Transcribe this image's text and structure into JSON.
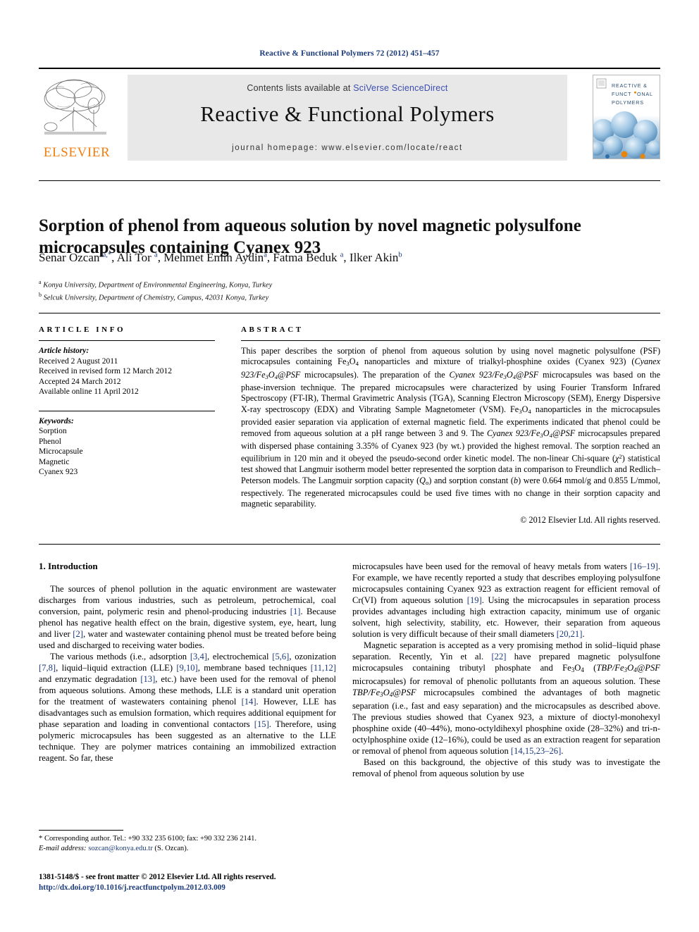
{
  "running_head": "Reactive & Functional Polymers 72 (2012) 451–457",
  "masthead": {
    "publisher_name": "ELSEVIER",
    "contents_prefix": "Contents lists available at ",
    "contents_link": "SciVerse ScienceDirect",
    "journal_title": "Reactive & Functional Polymers",
    "homepage_line": "journal homepage: www.elsevier.com/locate/react",
    "cover_title_line1": "REACTIVE &",
    "cover_title_line2": "FUNCTIONAL",
    "cover_title_line3": "POLYMERS"
  },
  "article": {
    "title": "Sorption of phenol from aqueous solution by novel magnetic polysulfone microcapsules containing Cyanex 923",
    "authors_html": "Senar Ozcan <sup>a,*</sup>, Ali Tor <sup>a</sup>, Mehmet Emin Aydin<sup>a</sup>, Fatma Beduk <sup>a</sup>, Ilker Akin<sup>b</sup>",
    "affiliation_a": "Konya University, Department of Environmental Engineering, Konya, Turkey",
    "affiliation_b": "Selcuk University, Department of Chemistry, Campus, 42031 Konya, Turkey"
  },
  "article_info": {
    "heading": "ARTICLE INFO",
    "history_label": "Article history:",
    "history": [
      "Received 2 August 2011",
      "Received in revised form 12 March 2012",
      "Accepted 24 March 2012",
      "Available online 11 April 2012"
    ],
    "keywords_label": "Keywords:",
    "keywords": [
      "Sorption",
      "Phenol",
      "Microcapsule",
      "Magnetic",
      "Cyanex 923"
    ]
  },
  "abstract": {
    "heading": "ABSTRACT",
    "text_html": "This paper describes the sorption of phenol from aqueous solution by using novel magnetic polysulfone (PSF) microcapsules containing Fe<sub>3</sub>O<sub>4</sub> nanoparticles and mixture of trialkyl-phosphine oxides (Cyanex 923) (<i>Cyanex 923/Fe<sub>3</sub>O<sub>4</sub>@PSF</i> microcapsules). The preparation of the <i>Cyanex 923/Fe<sub>3</sub>O<sub>4</sub>@PSF</i> microcapsules was based on the phase-inversion technique. The prepared microcapsules were characterized by using Fourier Transform Infrared Spectroscopy (FT-IR), Thermal Gravimetric Analysis (TGA), Scanning Electron Microscopy (SEM), Energy Dispersive X-ray spectroscopy (EDX) and Vibrating Sample Magnetometer (VSM). Fe<sub>3</sub>O<sub>4</sub> nanoparticles in the microcapsules provided easier separation via application of external magnetic field. The experiments indicated that phenol could be removed from aqueous solution at a pH range between 3 and 9. The <i>Cyanex 923/Fe<sub>3</sub>O<sub>4</sub>@PSF</i> microcapsules prepared with dispersed phase containing 3.35% of Cyanex 923 (by wt.) provided the highest removal. The sorption reached an equilibrium in 120 min and it obeyed the pseudo-second order kinetic model. The non-linear Chi-square (<i>χ</i><sup class=\"ft\">2</sup>) statistical test showed that Langmuir isotherm model better represented the sorption data in comparison to Freundlich and Redlich–Peterson models. The Langmuir sorption capacity (<i>Q</i><sub>o</sub>) and sorption constant (<i>b</i>) were 0.664 mmol/g and 0.855 L/mmol, respectively. The regenerated microcapsules could be used five times with no change in their sorption capacity and magnetic separability.",
    "copyright": "© 2012 Elsevier Ltd. All rights reserved."
  },
  "body": {
    "section_heading": "1. Introduction",
    "left_paragraphs_html": [
      "The sources of phenol pollution in the aquatic environment are wastewater discharges from various industries, such as petroleum, petrochemical, coal conversion, paint, polymeric resin and phenol-producing industries <span class=\"ref\">[1]</span>. Because phenol has negative health effect on the brain, digestive system, eye, heart, lung and liver <span class=\"ref\">[2]</span>, water and wastewater containing phenol must be treated before being used and discharged to receiving water bodies.",
      "The various methods (i.e., adsorption <span class=\"ref\">[3,4]</span>, electrochemical <span class=\"ref\">[5,6]</span>, ozonization <span class=\"ref\">[7,8]</span>, liquid–liquid extraction (LLE) <span class=\"ref\">[9,10]</span>, membrane based techniques <span class=\"ref\">[11,12]</span> and enzymatic degradation <span class=\"ref\">[13]</span>, etc.) have been used for the removal of phenol from aqueous solutions. Among these methods, LLE is a standard unit operation for the treatment of wastewaters containing phenol <span class=\"ref\">[14]</span>. However, LLE has disadvantages such as emulsion formation, which requires additional equipment for phase separation and loading in conventional contactors <span class=\"ref\">[15]</span>. Therefore, using polymeric microcapsules has been suggested as an alternative to the LLE technique. They are polymer matrices containing an immobilized extraction reagent. So far, these"
    ],
    "right_paragraphs_html": [
      "microcapsules have been used for the removal of heavy metals from waters <span class=\"ref\">[16–19]</span>. For example, we have recently reported a study that describes employing polysulfone microcapsules containing Cyanex 923 as extraction reagent for efficient removal of Cr(VI) from aqueous solution <span class=\"ref\">[19]</span>. Using the microcapsules in separation process provides advantages including high extraction capacity, minimum use of organic solvent, high selectivity, stability, etc. However, their separation from aqueous solution is very difficult because of their small diameters <span class=\"ref\">[20,21]</span>.",
      "Magnetic separation is accepted as a very promising method in solid–liquid phase separation. Recently, Yin et al. <span class=\"ref\">[22]</span> have prepared magnetic polysulfone microcapsules containing tributyl phosphate and Fe<sub>3</sub>O<sub>4</sub> (<i>TBP/Fe<sub>3</sub>O<sub>4</sub>@PSF</i> microcapsules) for removal of phenolic pollutants from an aqueous solution. These <i>TBP/Fe<sub>3</sub>O<sub>4</sub>@PSF</i> microcapsules combined the advantages of both magnetic separation (i.e., fast and easy separation) and the microcapsules as described above. The previous studies showed that Cyanex 923, a mixture of dioctyl-monohexyl phosphine oxide (40–44%), mono-octyldihexyl phosphine oxide (28–32%) and tri-n-octylphosphine oxide (12–16%), could be used as an extraction reagent for separation or removal of phenol from aqueous solution <span class=\"ref\">[14,15,23–26]</span>.",
      "Based on this background, the objective of this study was to investigate the removal of phenol from aqueous solution by use"
    ]
  },
  "footnote": {
    "corresponding_html": "<span class=\"ind\">* Corresponding author. Tel.: +90 332 235 6100; fax: +90 332 236 2141.</span>",
    "email_html": "<span class=\"ind\"><i>E-mail address:</i> <a href=\"#\">sozcan@konya.edu.tr</a> (S. Ozcan).</span>"
  },
  "colophon": {
    "line1": "1381-5148/$ - see front matter © 2012 Elsevier Ltd. All rights reserved.",
    "doi": "http://dx.doi.org/10.1016/j.reactfunctpolym.2012.03.009"
  },
  "colors": {
    "link": "#3b4db0",
    "reference": "#1b3a7a",
    "elsevier_orange": "#F07F12",
    "band_gray": "#e8e8e8"
  }
}
